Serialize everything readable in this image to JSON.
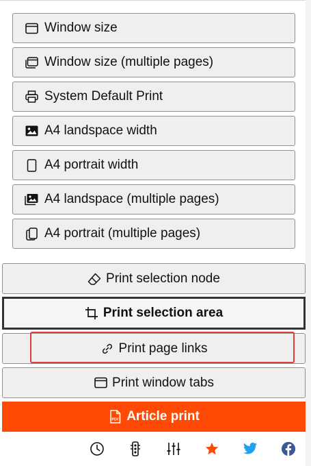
{
  "menu": {
    "window_size": "Window size",
    "window_size_multi": "Window size (multiple pages)",
    "system_default_print": "System Default Print",
    "a4_landscape_width": "A4 landspace width",
    "a4_portrait_width": "A4 portrait width",
    "a4_landscape_multi": "A4 landspace (multiple pages)",
    "a4_portrait_multi": "A4 portrait (multiple pages)"
  },
  "actions": {
    "print_selection_node": "Print selection node",
    "print_selection_area": "Print selection area",
    "print_page_links": "Print page links",
    "print_window_tabs": "Print window tabs",
    "article_print": "Article print"
  },
  "footer_icons": [
    "history-icon",
    "traffic-light-icon",
    "sliders-icon",
    "star-icon",
    "twitter-icon",
    "facebook-icon"
  ],
  "colors": {
    "article_bg": "#ff4a06",
    "highlight": "#e43b3b",
    "star": "#ff4a06",
    "twitter": "#1da1f2",
    "facebook": "#3b5998"
  }
}
